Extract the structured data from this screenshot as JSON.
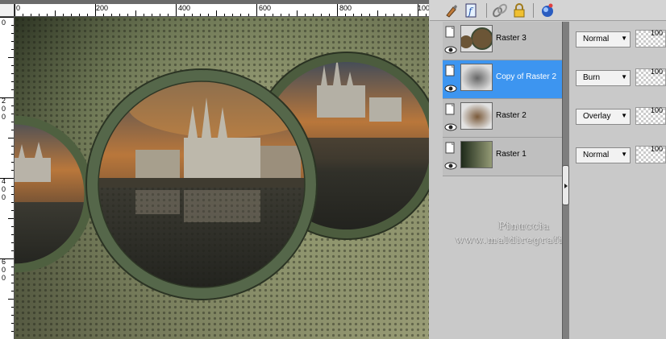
{
  "ruler": {
    "top_labels": [
      "0",
      "200",
      "400",
      "600",
      "800",
      "100"
    ],
    "left_labels": [
      "0",
      "2",
      "0",
      "0",
      "4",
      "0",
      "0",
      "6",
      "0",
      "0"
    ]
  },
  "layers": [
    {
      "name": "Raster 3",
      "blend_mode": "Normal",
      "opacity": "100",
      "selected": false,
      "thumb": "circle-scene"
    },
    {
      "name": "Copy of Raster 2",
      "blend_mode": "Burn",
      "opacity": "100",
      "selected": true,
      "thumb": "soft-blur"
    },
    {
      "name": "Raster 2",
      "blend_mode": "Overlay",
      "opacity": "100",
      "selected": false,
      "thumb": "brown-blur"
    },
    {
      "name": "Raster 1",
      "blend_mode": "Normal",
      "opacity": "100",
      "selected": false,
      "thumb": "green-gradient"
    }
  ],
  "watermark": {
    "line1": "Pinuccia",
    "line2": "www.maldiregrafica.eu"
  },
  "toolbar_icons": [
    "brush-icon",
    "script-icon",
    "link-icon",
    "lock-icon",
    "mask-icon"
  ],
  "colors": {
    "selection": "#3d95f0",
    "panel_bg": "#c9c9c9",
    "ring_green": "#5c6e4e"
  }
}
